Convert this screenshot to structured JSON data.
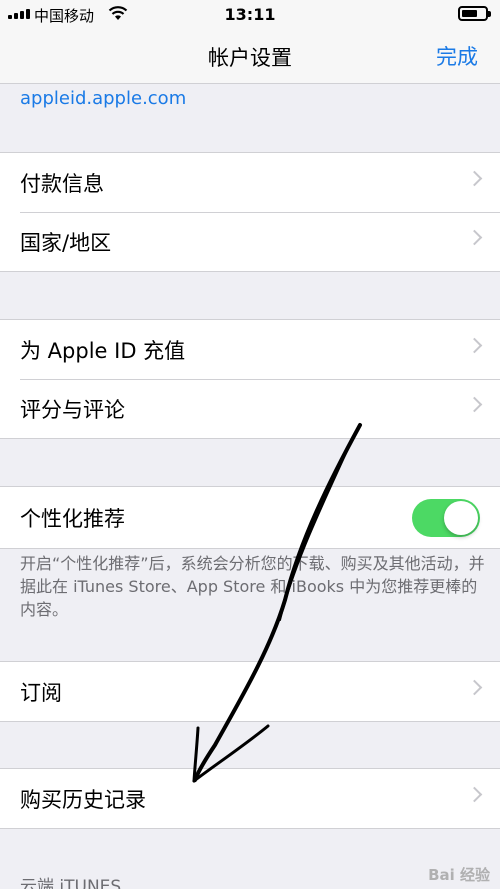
{
  "status_bar": {
    "carrier": "中国移动",
    "time": "13:11",
    "battery_level": 0.7
  },
  "nav": {
    "title": "帐户设置",
    "done_label": "完成"
  },
  "link": {
    "text": "appleid.apple.com"
  },
  "group1": [
    {
      "label": "付款信息"
    },
    {
      "label": "国家/地区"
    }
  ],
  "group2": [
    {
      "label": "为 Apple ID 充值"
    },
    {
      "label": "评分与评论"
    }
  ],
  "personalization": {
    "label": "个性化推荐",
    "toggle_on": true,
    "toggle_color": "#4cd964",
    "note": "开启“个性化推荐”后，系统会分析您的下载、购买及其他活动，并据此在 iTunes Store、App Store 和 iBooks 中为您推荐更棒的内容。"
  },
  "group3": [
    {
      "label": "订阅"
    }
  ],
  "group4": [
    {
      "label": "购买历史记录"
    }
  ],
  "section_header": "云端 iTUNES",
  "watermark": "Bai 经验",
  "colors": {
    "link": "#1a7ae6",
    "background": "#efeff4",
    "chevron": "#c7c7cc"
  }
}
